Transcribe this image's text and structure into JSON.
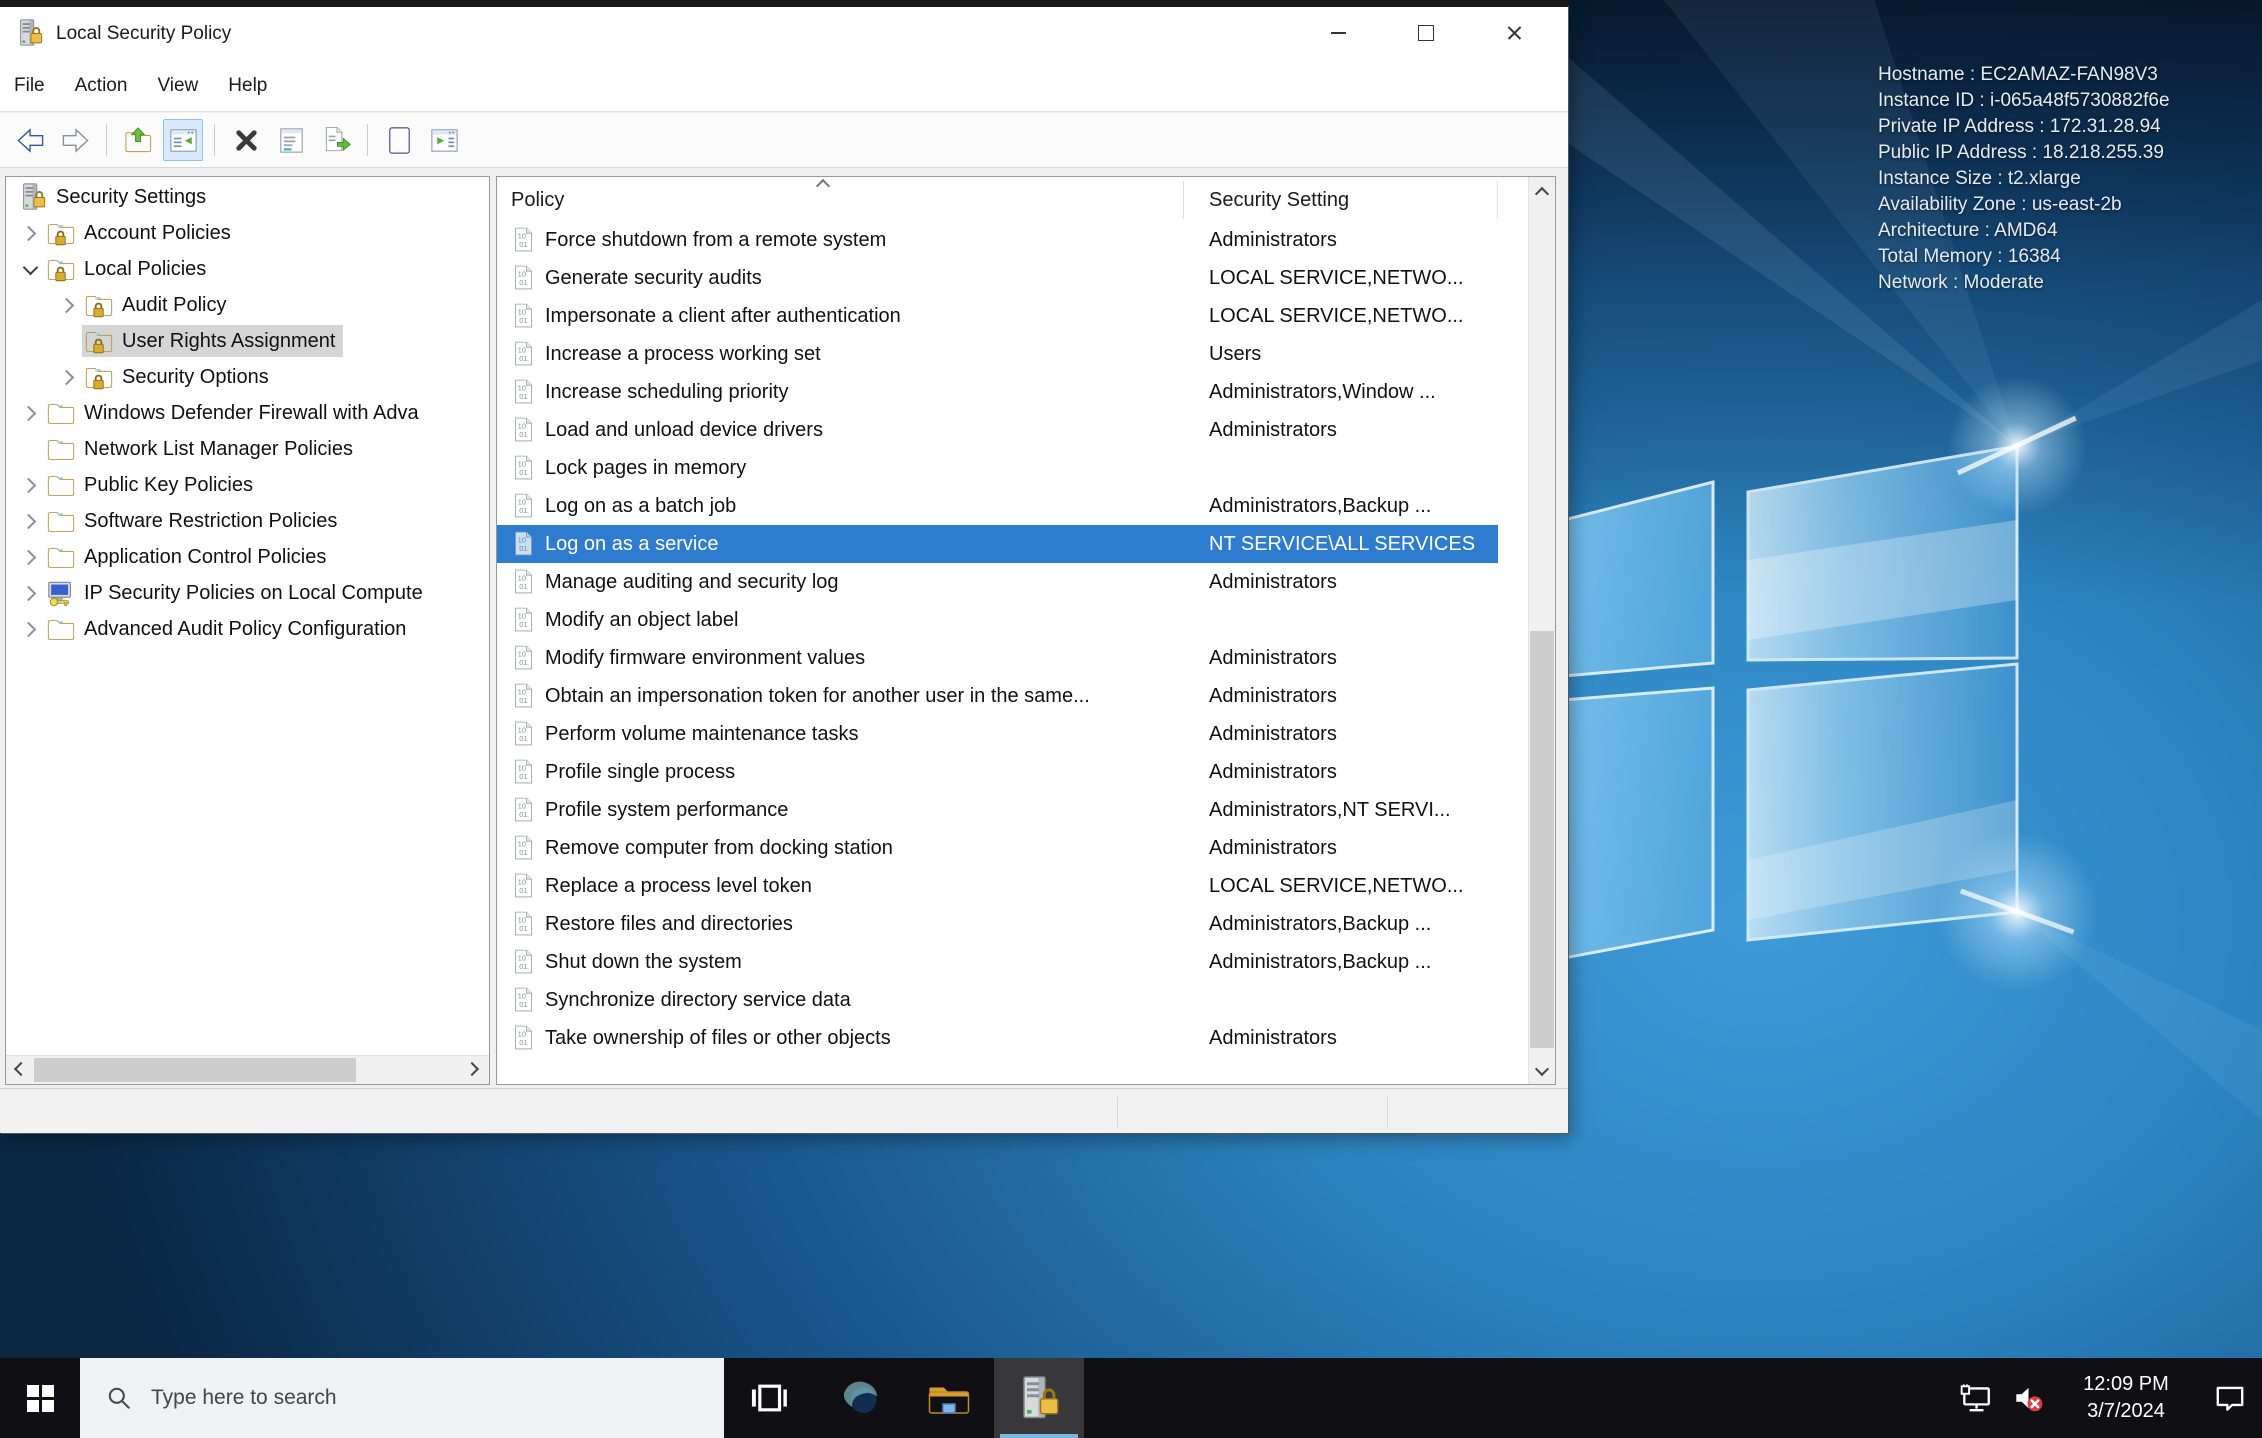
{
  "window": {
    "title": "Local Security Policy",
    "controls": [
      "minimize",
      "maximize",
      "close"
    ],
    "menu": [
      "File",
      "Action",
      "View",
      "Help"
    ],
    "toolbar": [
      "back",
      "forward",
      "sep",
      "folder-up",
      "console-tree",
      "sep",
      "delete",
      "properties",
      "export-list",
      "sep",
      "help",
      "action-pane"
    ],
    "tree": [
      {
        "label": "Security Settings",
        "level": 0,
        "expander": "none",
        "icon": "tower-lock",
        "selected": false
      },
      {
        "label": "Account Policies",
        "level": 1,
        "expander": "collapsed",
        "icon": "folder-lock",
        "selected": false
      },
      {
        "label": "Local Policies",
        "level": 1,
        "expander": "expanded",
        "icon": "folder-lock",
        "selected": false
      },
      {
        "label": "Audit Policy",
        "level": 2,
        "expander": "collapsed",
        "icon": "folder-lock",
        "selected": false
      },
      {
        "label": "User Rights Assignment",
        "level": 2,
        "expander": "none",
        "icon": "folder-lock",
        "selected": true
      },
      {
        "label": "Security Options",
        "level": 2,
        "expander": "collapsed",
        "icon": "folder-lock",
        "selected": false
      },
      {
        "label": "Windows Defender Firewall with Adva",
        "level": 1,
        "expander": "collapsed",
        "icon": "folder",
        "selected": false
      },
      {
        "label": "Network List Manager Policies",
        "level": 1,
        "expander": "none",
        "icon": "folder",
        "selected": false
      },
      {
        "label": "Public Key Policies",
        "level": 1,
        "expander": "collapsed",
        "icon": "folder",
        "selected": false
      },
      {
        "label": "Software Restriction Policies",
        "level": 1,
        "expander": "collapsed",
        "icon": "folder",
        "selected": false
      },
      {
        "label": "Application Control Policies",
        "level": 1,
        "expander": "collapsed",
        "icon": "folder",
        "selected": false
      },
      {
        "label": "IP Security Policies on Local Compute",
        "level": 1,
        "expander": "collapsed",
        "icon": "computer-key",
        "selected": false
      },
      {
        "label": "Advanced Audit Policy Configuration",
        "level": 1,
        "expander": "collapsed",
        "icon": "folder",
        "selected": false
      }
    ],
    "list": {
      "columns": [
        "Policy",
        "Security Setting"
      ],
      "rows": [
        {
          "policy": "Force shutdown from a remote system",
          "setting": "Administrators",
          "selected": false
        },
        {
          "policy": "Generate security audits",
          "setting": "LOCAL SERVICE,NETWO...",
          "selected": false
        },
        {
          "policy": "Impersonate a client after authentication",
          "setting": "LOCAL SERVICE,NETWO...",
          "selected": false
        },
        {
          "policy": "Increase a process working set",
          "setting": "Users",
          "selected": false
        },
        {
          "policy": "Increase scheduling priority",
          "setting": "Administrators,Window ...",
          "selected": false
        },
        {
          "policy": "Load and unload device drivers",
          "setting": "Administrators",
          "selected": false
        },
        {
          "policy": "Lock pages in memory",
          "setting": "",
          "selected": false
        },
        {
          "policy": "Log on as a batch job",
          "setting": "Administrators,Backup ...",
          "selected": false
        },
        {
          "policy": "Log on as a service",
          "setting": "NT SERVICE\\ALL SERVICES",
          "selected": true
        },
        {
          "policy": "Manage auditing and security log",
          "setting": "Administrators",
          "selected": false
        },
        {
          "policy": "Modify an object label",
          "setting": "",
          "selected": false
        },
        {
          "policy": "Modify firmware environment values",
          "setting": "Administrators",
          "selected": false
        },
        {
          "policy": "Obtain an impersonation token for another user in the same...",
          "setting": "Administrators",
          "selected": false
        },
        {
          "policy": "Perform volume maintenance tasks",
          "setting": "Administrators",
          "selected": false
        },
        {
          "policy": "Profile single process",
          "setting": "Administrators",
          "selected": false
        },
        {
          "policy": "Profile system performance",
          "setting": "Administrators,NT SERVI...",
          "selected": false
        },
        {
          "policy": "Remove computer from docking station",
          "setting": "Administrators",
          "selected": false
        },
        {
          "policy": "Replace a process level token",
          "setting": "LOCAL SERVICE,NETWO...",
          "selected": false
        },
        {
          "policy": "Restore files and directories",
          "setting": "Administrators,Backup ...",
          "selected": false
        },
        {
          "policy": "Shut down the system",
          "setting": "Administrators,Backup ...",
          "selected": false
        },
        {
          "policy": "Synchronize directory service data",
          "setting": "",
          "selected": false
        },
        {
          "policy": "Take ownership of files or other objects",
          "setting": "Administrators",
          "selected": false
        }
      ]
    }
  },
  "desktop": {
    "info_lines": [
      "Hostname : EC2AMAZ-FAN98V3",
      "Instance ID : i-065a48f5730882f6e",
      "Private IP Address : 172.31.28.94",
      "Public IP Address : 18.218.255.39",
      "Instance Size : t2.xlarge",
      "Availability Zone : us-east-2b",
      "Architecture : AMD64",
      "Total Memory : 16384",
      "Network : Moderate"
    ]
  },
  "taskbar": {
    "search_placeholder": "Type here to search",
    "time": "12:09 PM",
    "date": "3/7/2024"
  },
  "colors": {
    "selection_blue": "#2e7ccf",
    "tree_selection_gray": "#d5d5d5",
    "taskbar_accent": "#76b9e8"
  }
}
